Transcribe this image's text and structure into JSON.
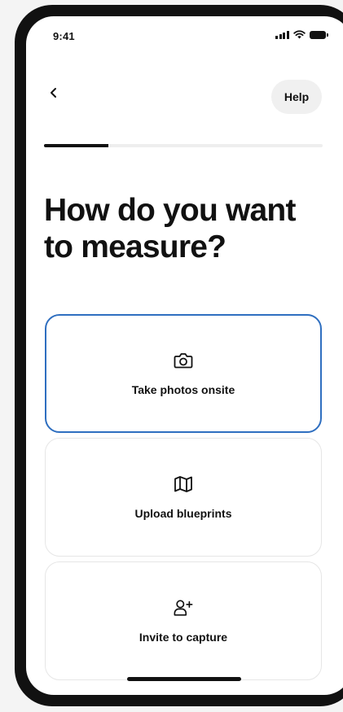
{
  "status_bar": {
    "time": "9:41"
  },
  "nav": {
    "help_label": "Help"
  },
  "progress": {
    "fraction": 0.23
  },
  "title": {
    "line1": "How do you want",
    "line2": "to measure?"
  },
  "options": [
    {
      "label": "Take photos onsite",
      "icon": "camera-icon",
      "selected": true
    },
    {
      "label": "Upload blueprints",
      "icon": "map-icon",
      "selected": false
    },
    {
      "label": "Invite to capture",
      "icon": "user-plus-icon",
      "selected": false
    }
  ],
  "colors": {
    "selected_border": "#2f6fc0",
    "text": "#111111",
    "help_bg": "#f0f0f0"
  }
}
